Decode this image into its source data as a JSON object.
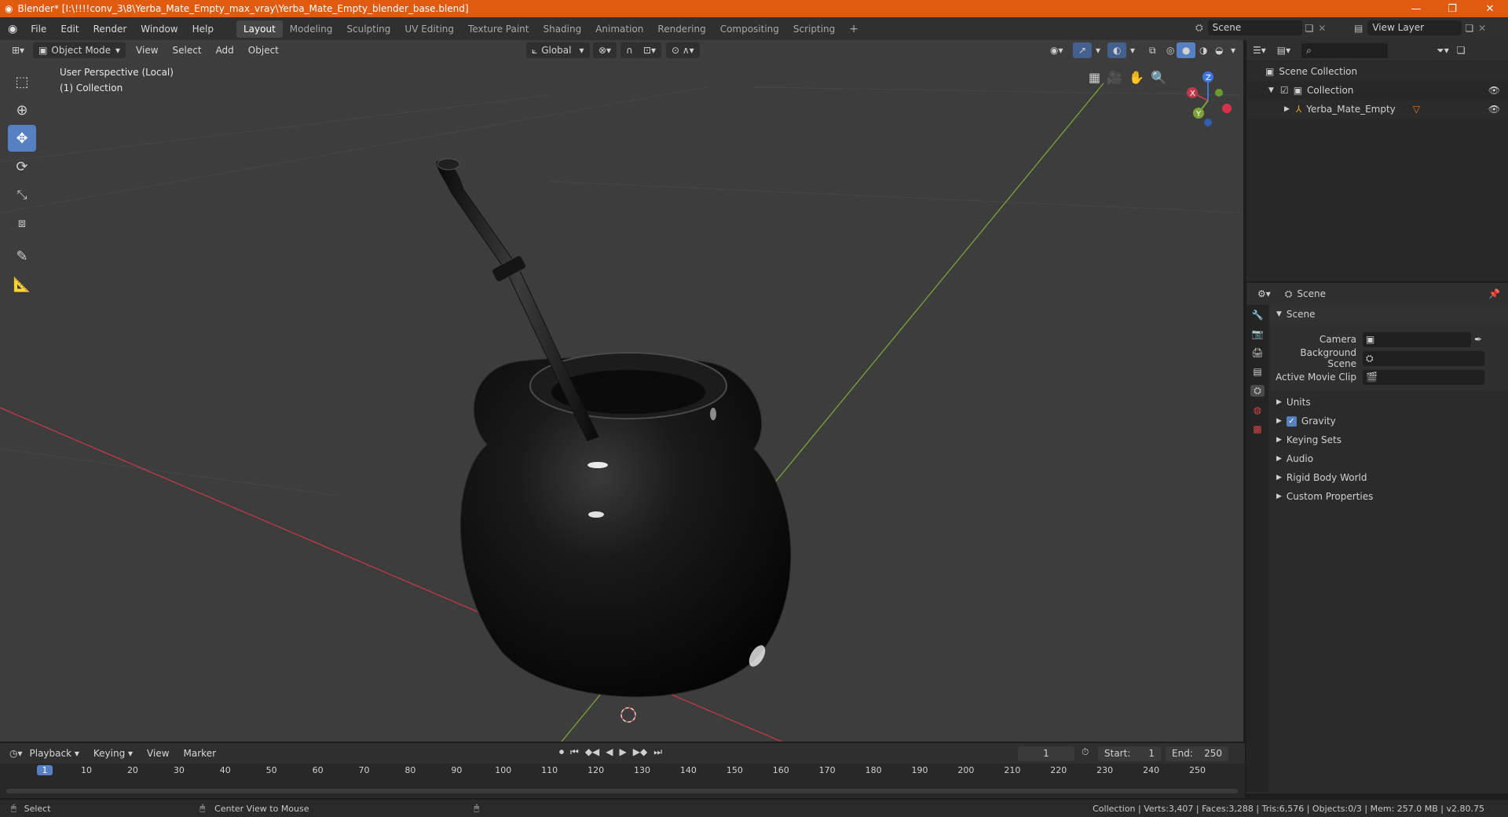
{
  "window": {
    "title": "Blender* [I:\\!!!!conv_3\\8\\Yerba_Mate_Empty_max_vray\\Yerba_Mate_Empty_blender_base.blend]"
  },
  "menubar": {
    "menus": [
      "File",
      "Edit",
      "Render",
      "Window",
      "Help"
    ],
    "workspaces": [
      "Layout",
      "Modeling",
      "Sculpting",
      "UV Editing",
      "Texture Paint",
      "Shading",
      "Animation",
      "Rendering",
      "Compositing",
      "Scripting"
    ],
    "active_workspace": "Layout",
    "scene_name": "Scene",
    "view_layer": "View Layer"
  },
  "viewport": {
    "mode": "Object Mode",
    "menus": [
      "View",
      "Select",
      "Add",
      "Object"
    ],
    "transform_orientation": "Global",
    "overlay_line1": "User Perspective (Local)",
    "overlay_line2": "(1) Collection"
  },
  "outliner": {
    "root": "Scene Collection",
    "collection": "Collection",
    "object": "Yerba_Mate_Empty"
  },
  "properties": {
    "header": "Scene",
    "section": "Scene",
    "fields": [
      {
        "label": "Camera"
      },
      {
        "label": "Background Scene"
      },
      {
        "label": "Active Movie Clip"
      }
    ],
    "panels": [
      "Units",
      "Gravity",
      "Keying Sets",
      "Audio",
      "Rigid Body World",
      "Custom Properties"
    ],
    "gravity_checked": true
  },
  "timeline": {
    "menus": [
      "Playback",
      "Keying",
      "View",
      "Marker"
    ],
    "current_frame": "1",
    "start_label": "Start:",
    "start": "1",
    "end_label": "End:",
    "end": "250",
    "ruler": [
      "1",
      "10",
      "20",
      "30",
      "40",
      "50",
      "60",
      "70",
      "80",
      "90",
      "100",
      "110",
      "120",
      "130",
      "140",
      "150",
      "160",
      "170",
      "180",
      "190",
      "200",
      "210",
      "220",
      "230",
      "240",
      "250"
    ]
  },
  "statusbar": {
    "left_action": "Select",
    "middle_action": "Center View to Mouse",
    "stats": "Collection | Verts:3,407 | Faces:3,288 | Tris:6,576 | Objects:0/3 | Mem: 257.0 MB | v2.80.75"
  },
  "colors": {
    "titlebar": "#e05a10",
    "viewport_bg": "#3d3d3d",
    "accent": "#5680c2",
    "x_axis": "#c0394a",
    "y_axis": "#7ba33a"
  }
}
